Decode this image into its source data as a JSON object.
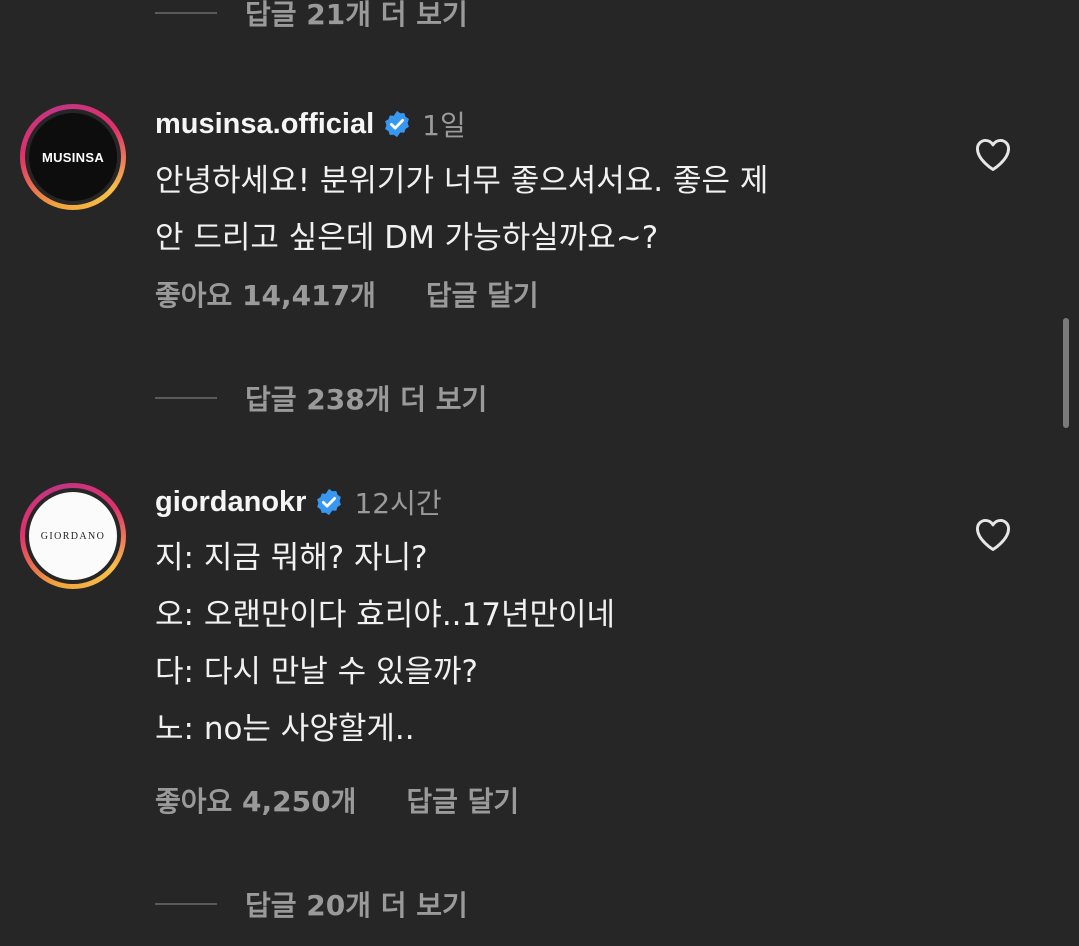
{
  "replies_top": {
    "label": "답글 21개 더 보기"
  },
  "comment1": {
    "avatar_text": "MUSINSA",
    "username": "musinsa.official",
    "time": "1일",
    "lines": [
      "안녕하세요! 분위기가 너무 좋으셔서요. 좋은 제",
      "안 드리고 싶은데 DM 가능하실까요~?"
    ],
    "likes": "좋아요 14,417개",
    "reply": "답글 달기",
    "replies_more": "답글 238개 더 보기"
  },
  "comment2": {
    "avatar_text": "GIORDANO",
    "username": "giordanokr",
    "time": "12시간",
    "lines": [
      "지: 지금 뭐해? 자니?",
      "오: 오랜만이다 효리야..17년만이네",
      "다: 다시 만날 수 있을까?",
      "노: no는 사양할게.."
    ],
    "likes": "좋아요 4,250개",
    "reply": "답글 달기",
    "replies_more": "답글 20개 더 보기"
  },
  "colors": {
    "background": "#262626",
    "verified": "#3897f0",
    "muted_text": "#9a9a9a"
  },
  "icons": [
    "verified-badge-icon",
    "heart-icon"
  ]
}
